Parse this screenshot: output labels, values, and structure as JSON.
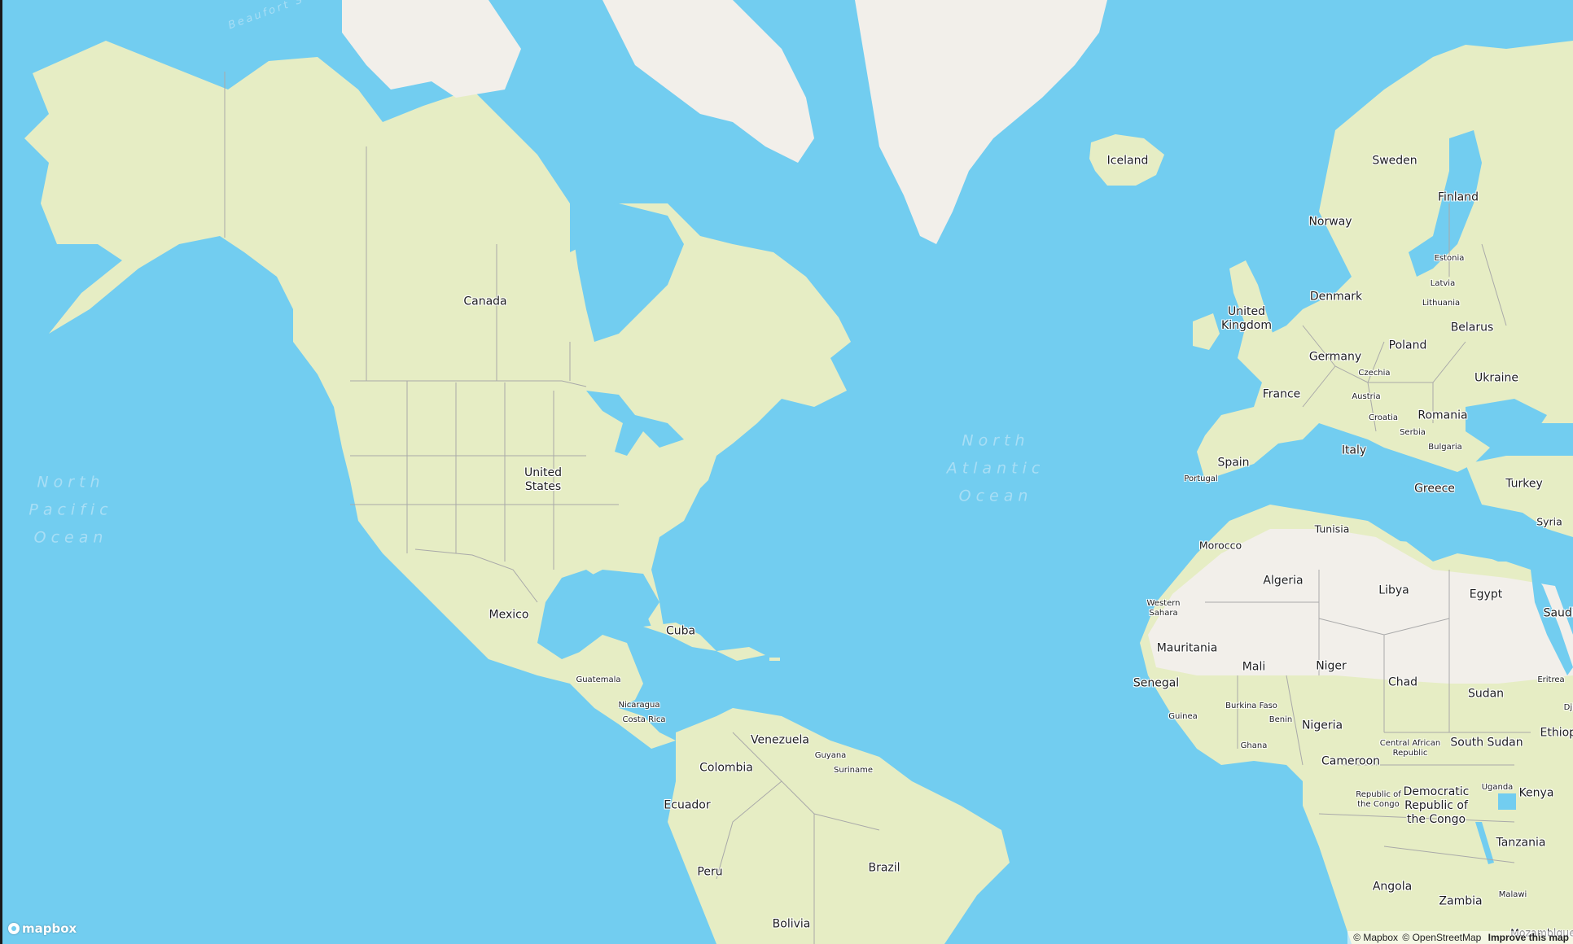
{
  "map": {
    "provider": "mapbox",
    "colors": {
      "water": "#72cdf0",
      "land": "#e6edc4",
      "desert": "#eee9e2",
      "ice": "#f2efea",
      "border": "#8f8f8f",
      "label": "#1d1d1d",
      "ocean_label": "#a8def5"
    },
    "oceans": [
      {
        "name": "North Pacific Ocean",
        "text": "North\nPacific\nOcean"
      },
      {
        "name": "North Atlantic Ocean",
        "text": "North\nAtlantic\nOcean"
      }
    ],
    "seas": [
      {
        "name": "Beaufort Sea",
        "text": "Beaufort S"
      }
    ],
    "labels": [
      {
        "text": "Canada",
        "size": "c1"
      },
      {
        "text": "United States",
        "size": "c1"
      },
      {
        "text": "Mexico",
        "size": "c1"
      },
      {
        "text": "Cuba",
        "size": "c1"
      },
      {
        "text": "Guatemala",
        "size": "c3"
      },
      {
        "text": "Nicaragua",
        "size": "c3"
      },
      {
        "text": "Costa Rica",
        "size": "c3"
      },
      {
        "text": "Venezuela",
        "size": "c1"
      },
      {
        "text": "Guyana",
        "size": "c3"
      },
      {
        "text": "Suriname",
        "size": "c3"
      },
      {
        "text": "Colombia",
        "size": "c1"
      },
      {
        "text": "Ecuador",
        "size": "c1"
      },
      {
        "text": "Peru",
        "size": "c1"
      },
      {
        "text": "Brazil",
        "size": "c1"
      },
      {
        "text": "Bolivia",
        "size": "c1"
      },
      {
        "text": "Iceland",
        "size": "c1"
      },
      {
        "text": "Sweden",
        "size": "c1"
      },
      {
        "text": "Finland",
        "size": "c1"
      },
      {
        "text": "Norway",
        "size": "c1"
      },
      {
        "text": "Estonia",
        "size": "c3"
      },
      {
        "text": "Latvia",
        "size": "c3"
      },
      {
        "text": "Lithuania",
        "size": "c3"
      },
      {
        "text": "Denmark",
        "size": "c1"
      },
      {
        "text": "United Kingdom",
        "size": "c1"
      },
      {
        "text": "Belarus",
        "size": "c1"
      },
      {
        "text": "Poland",
        "size": "c1"
      },
      {
        "text": "Germany",
        "size": "c1"
      },
      {
        "text": "Czechia",
        "size": "c3"
      },
      {
        "text": "Ukraine",
        "size": "c1"
      },
      {
        "text": "France",
        "size": "c1"
      },
      {
        "text": "Austria",
        "size": "c3"
      },
      {
        "text": "Croatia",
        "size": "c3"
      },
      {
        "text": "Romania",
        "size": "c1"
      },
      {
        "text": "Serbia",
        "size": "c3"
      },
      {
        "text": "Bulgaria",
        "size": "c3"
      },
      {
        "text": "Italy",
        "size": "c1"
      },
      {
        "text": "Spain",
        "size": "c1"
      },
      {
        "text": "Portugal",
        "size": "c3"
      },
      {
        "text": "Greece",
        "size": "c1"
      },
      {
        "text": "Turkey",
        "size": "c1"
      },
      {
        "text": "Syria",
        "size": "c2"
      },
      {
        "text": "Tunisia",
        "size": "c2"
      },
      {
        "text": "Morocco",
        "size": "c2"
      },
      {
        "text": "Algeria",
        "size": "c1"
      },
      {
        "text": "Libya",
        "size": "c1"
      },
      {
        "text": "Egypt",
        "size": "c1"
      },
      {
        "text": "Western Sahara",
        "size": "c3"
      },
      {
        "text": "Mauritania",
        "size": "c1"
      },
      {
        "text": "Mali",
        "size": "c1"
      },
      {
        "text": "Niger",
        "size": "c1"
      },
      {
        "text": "Chad",
        "size": "c1"
      },
      {
        "text": "Sudan",
        "size": "c1"
      },
      {
        "text": "Eritrea",
        "size": "c3"
      },
      {
        "text": "Senegal",
        "size": "c1"
      },
      {
        "text": "Guinea",
        "size": "c3"
      },
      {
        "text": "Burkina Faso",
        "size": "c3"
      },
      {
        "text": "Benin",
        "size": "c3"
      },
      {
        "text": "Nigeria",
        "size": "c1"
      },
      {
        "text": "Ghana",
        "size": "c3"
      },
      {
        "text": "Central African Republic",
        "size": "c3"
      },
      {
        "text": "South Sudan",
        "size": "c1"
      },
      {
        "text": "Ethiopia",
        "size": "c1"
      },
      {
        "text": "Cameroon",
        "size": "c1"
      },
      {
        "text": "Republic of the Congo",
        "size": "c3"
      },
      {
        "text": "Democratic Republic of the Congo",
        "size": "c1"
      },
      {
        "text": "Uganda",
        "size": "c3"
      },
      {
        "text": "Kenya",
        "size": "c1"
      },
      {
        "text": "Tanzania",
        "size": "c1"
      },
      {
        "text": "Angola",
        "size": "c1"
      },
      {
        "text": "Zambia",
        "size": "c1"
      },
      {
        "text": "Malawi",
        "size": "c3"
      },
      {
        "text": "Mozambique",
        "size": "c2"
      },
      {
        "text": "Saudi Arabia",
        "size": "c1"
      },
      {
        "text": "Djibouti",
        "size": "c3"
      }
    ]
  },
  "footer": {
    "logo_text": "mapbox",
    "attribution_mapbox": "© Mapbox",
    "attribution_osm": "© OpenStreetMap",
    "improve_link": "Improve this map"
  }
}
